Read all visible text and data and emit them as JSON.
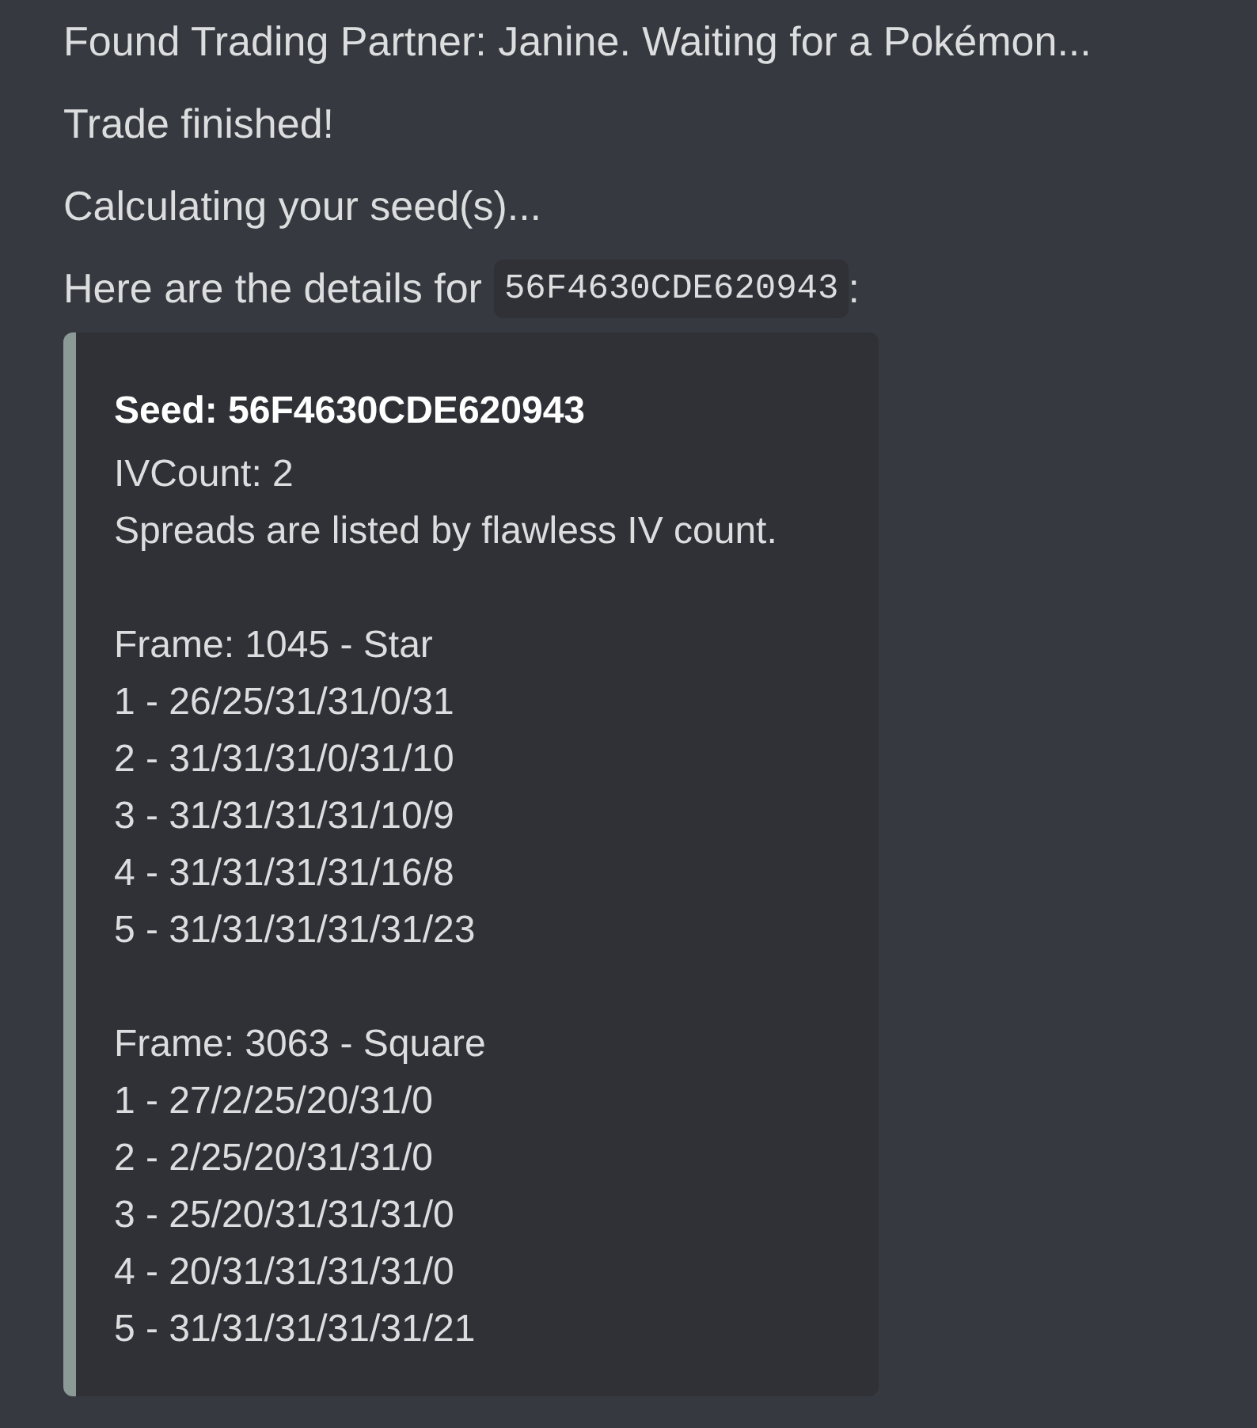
{
  "messages": [
    {
      "text": "Found Trading Partner: Janine. Waiting for a Pokémon..."
    },
    {
      "text": "Trade finished!"
    },
    {
      "text": "Calculating your seed(s)..."
    }
  ],
  "details_message": {
    "prefix": "Here are the details for",
    "code": "56F4630CDE620943",
    "suffix": ":"
  },
  "embed": {
    "title": "Seed: 56F4630CDE620943",
    "description": [
      "IVCount: 2",
      "Spreads are listed by flawless IV count."
    ],
    "frames": [
      {
        "title": "Frame: 1045 - Star",
        "spreads": [
          "1 - 26/25/31/31/0/31",
          "2 - 31/31/31/0/31/10",
          "3 - 31/31/31/31/10/9",
          "4 - 31/31/31/31/16/8",
          "5 - 31/31/31/31/31/23"
        ]
      },
      {
        "title": "Frame: 3063 - Square",
        "spreads": [
          "1 - 27/2/25/20/31/0",
          "2 - 2/25/20/31/31/0",
          "3 - 25/20/31/31/31/0",
          "4 - 20/31/31/31/31/0",
          "5 - 31/31/31/31/31/21"
        ]
      }
    ]
  }
}
